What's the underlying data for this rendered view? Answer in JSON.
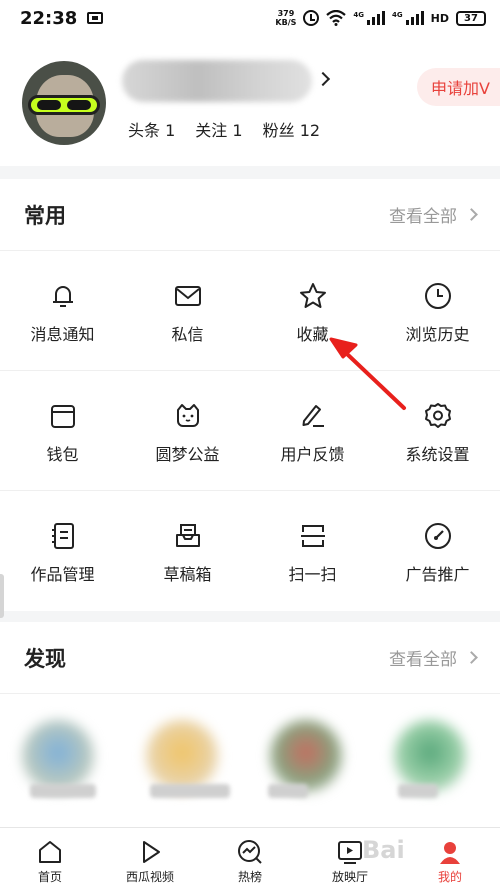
{
  "status_bar": {
    "time": "22:38",
    "net_speed_value": "379",
    "net_speed_unit": "KB/S",
    "sim1_label": "4G",
    "sim2_label": "4G",
    "hd_label": "HD",
    "battery": "37"
  },
  "profile": {
    "stats": [
      {
        "label": "头条",
        "value": "1"
      },
      {
        "label": "关注",
        "value": "1"
      },
      {
        "label": "粉丝",
        "value": "12"
      }
    ],
    "apply_badge": "申请加V"
  },
  "common": {
    "title": "常用",
    "more": "查看全部",
    "items": [
      {
        "label": "消息通知",
        "icon": "bell-icon"
      },
      {
        "label": "私信",
        "icon": "mail-icon"
      },
      {
        "label": "收藏",
        "icon": "star-icon"
      },
      {
        "label": "浏览历史",
        "icon": "clock-icon"
      },
      {
        "label": "钱包",
        "icon": "wallet-icon"
      },
      {
        "label": "圆梦公益",
        "icon": "cat-face-icon"
      },
      {
        "label": "用户反馈",
        "icon": "pen-icon"
      },
      {
        "label": "系统设置",
        "icon": "gear-icon"
      },
      {
        "label": "作品管理",
        "icon": "notebook-icon"
      },
      {
        "label": "草稿箱",
        "icon": "draft-box-icon"
      },
      {
        "label": "扫一扫",
        "icon": "scan-icon"
      },
      {
        "label": "广告推广",
        "icon": "gauge-icon"
      }
    ]
  },
  "discover": {
    "title": "发现",
    "more": "查看全部"
  },
  "bottom_nav": [
    {
      "label": "首页",
      "icon": "home-icon"
    },
    {
      "label": "西瓜视频",
      "icon": "play-icon"
    },
    {
      "label": "热榜",
      "icon": "trending-icon"
    },
    {
      "label": "放映厅",
      "icon": "tv-icon"
    },
    {
      "label": "我的",
      "icon": "profile-icon",
      "active": true
    }
  ],
  "watermark": "Bai",
  "colors": {
    "accent": "#e8413b",
    "badge_bg": "#fdeceb",
    "annotation_arrow": "#e8201c"
  }
}
